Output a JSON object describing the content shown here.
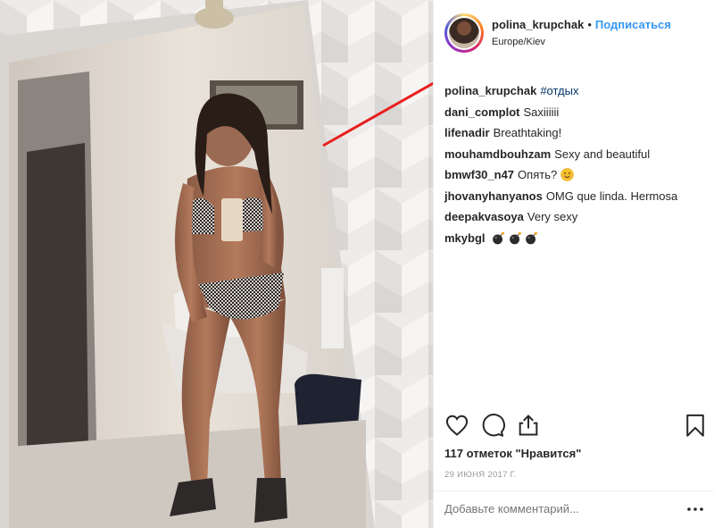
{
  "post": {
    "username": "polina_krupchak",
    "separator": "•",
    "follow_label": "Подписаться",
    "location": "Europe/Kiev",
    "likes_text": "117 отметок \"Нравится\"",
    "date_text": "29 ИЮНЯ 2017 Г.",
    "comment_placeholder": "Добавьте комментарий...",
    "more_label": "•••"
  },
  "comments": [
    {
      "user": "polina_krupchak",
      "text": "#отдых",
      "is_hashtag": true
    },
    {
      "user": "dani_complot",
      "text": "Saxiiiiii"
    },
    {
      "user": "lifenadir",
      "text": "Breathtaking!"
    },
    {
      "user": "mouhamdbouhzam",
      "text": "Sexy and beautiful"
    },
    {
      "user": "bmwf30_n47",
      "text": "Опять?",
      "emoji": "smiling-face"
    },
    {
      "user": "jhovanyhanyanos",
      "text": "OMG que linda. Hermosa"
    },
    {
      "user": "deepakvasoya",
      "text": "Very sexy"
    },
    {
      "user": "mkybgl",
      "text": "",
      "emoji": "bomb x3"
    }
  ],
  "colors": {
    "link_blue": "#3897f0",
    "hashtag": "#003569",
    "annotation_arrow": "#e8201f"
  },
  "icons": [
    "heart-icon",
    "comment-icon",
    "share-icon",
    "bookmark-icon",
    "more-options-icon"
  ]
}
